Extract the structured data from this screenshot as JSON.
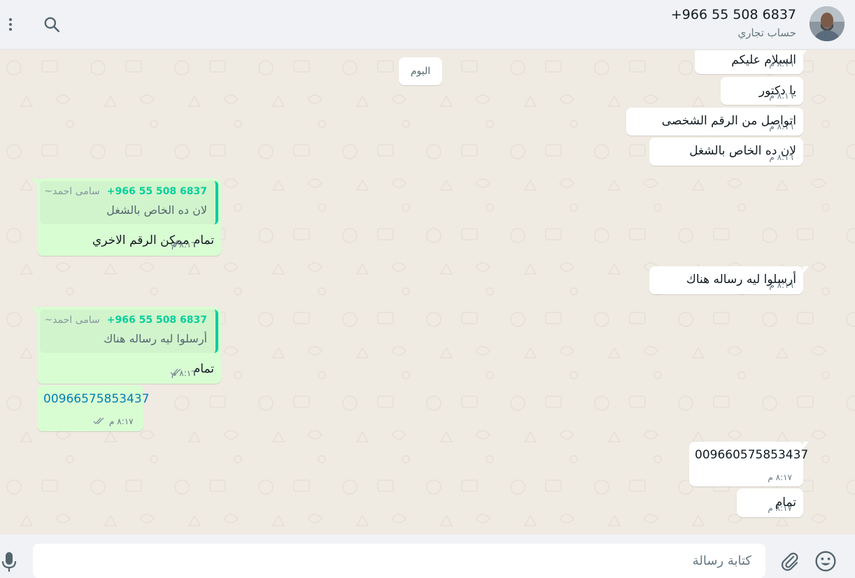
{
  "header": {
    "contact_name": "+966 55 508 6837",
    "contact_subtitle": "حساب تجاري"
  },
  "chat": {
    "day_label": "اليوم",
    "messages": [
      {
        "direction": "incoming",
        "text": "السلام عليكم",
        "time": "٨:١٦ م"
      },
      {
        "direction": "incoming",
        "text": "يا دكتور",
        "time": "٨:١٦ م"
      },
      {
        "direction": "incoming",
        "text": "اتواصل من الرقم الشخصى",
        "time": "٨:١٦ م"
      },
      {
        "direction": "incoming",
        "text": "لان ده الخاص بالشغل",
        "time": "٨:١٦ م"
      },
      {
        "direction": "outgoing",
        "quoted_number": "+966 55 508 6837",
        "quoted_name": "~سامى احمد",
        "quoted_text": "لان ده الخاص بالشغل",
        "text": "تمام ممكن الرقم الاخري",
        "time": "٨:١٦ م"
      },
      {
        "direction": "incoming",
        "text": "أرسلوا ليه رساله هناك",
        "time": "٨:١٦ م"
      },
      {
        "direction": "outgoing",
        "quoted_number": "+966 55 508 6837",
        "quoted_name": "~سامى احمد",
        "quoted_text": "أرسلوا ليه رساله هناك",
        "text": "تمام",
        "time": "٨:١٦ م"
      },
      {
        "direction": "outgoing",
        "text": "00966575853437",
        "time": "٨:١٧ م"
      },
      {
        "direction": "incoming",
        "text": "009660575853437",
        "time": "٨:١٧ م"
      },
      {
        "direction": "incoming",
        "text": "تمام",
        "time": "٨:١٧ م"
      }
    ]
  },
  "composer": {
    "placeholder": "كتابة رسالة"
  },
  "icons": {
    "menu": "kebab-menu-icon",
    "search": "search-icon",
    "emoji": "emoji-icon",
    "attach": "paperclip-icon",
    "mic": "microphone-icon"
  },
  "colors": {
    "outgoing_bubble": "#d9fdd3",
    "incoming_bubble": "#ffffff",
    "chat_background": "#efeae2",
    "quote_accent": "#06cf9c",
    "link": "#027eb5"
  }
}
